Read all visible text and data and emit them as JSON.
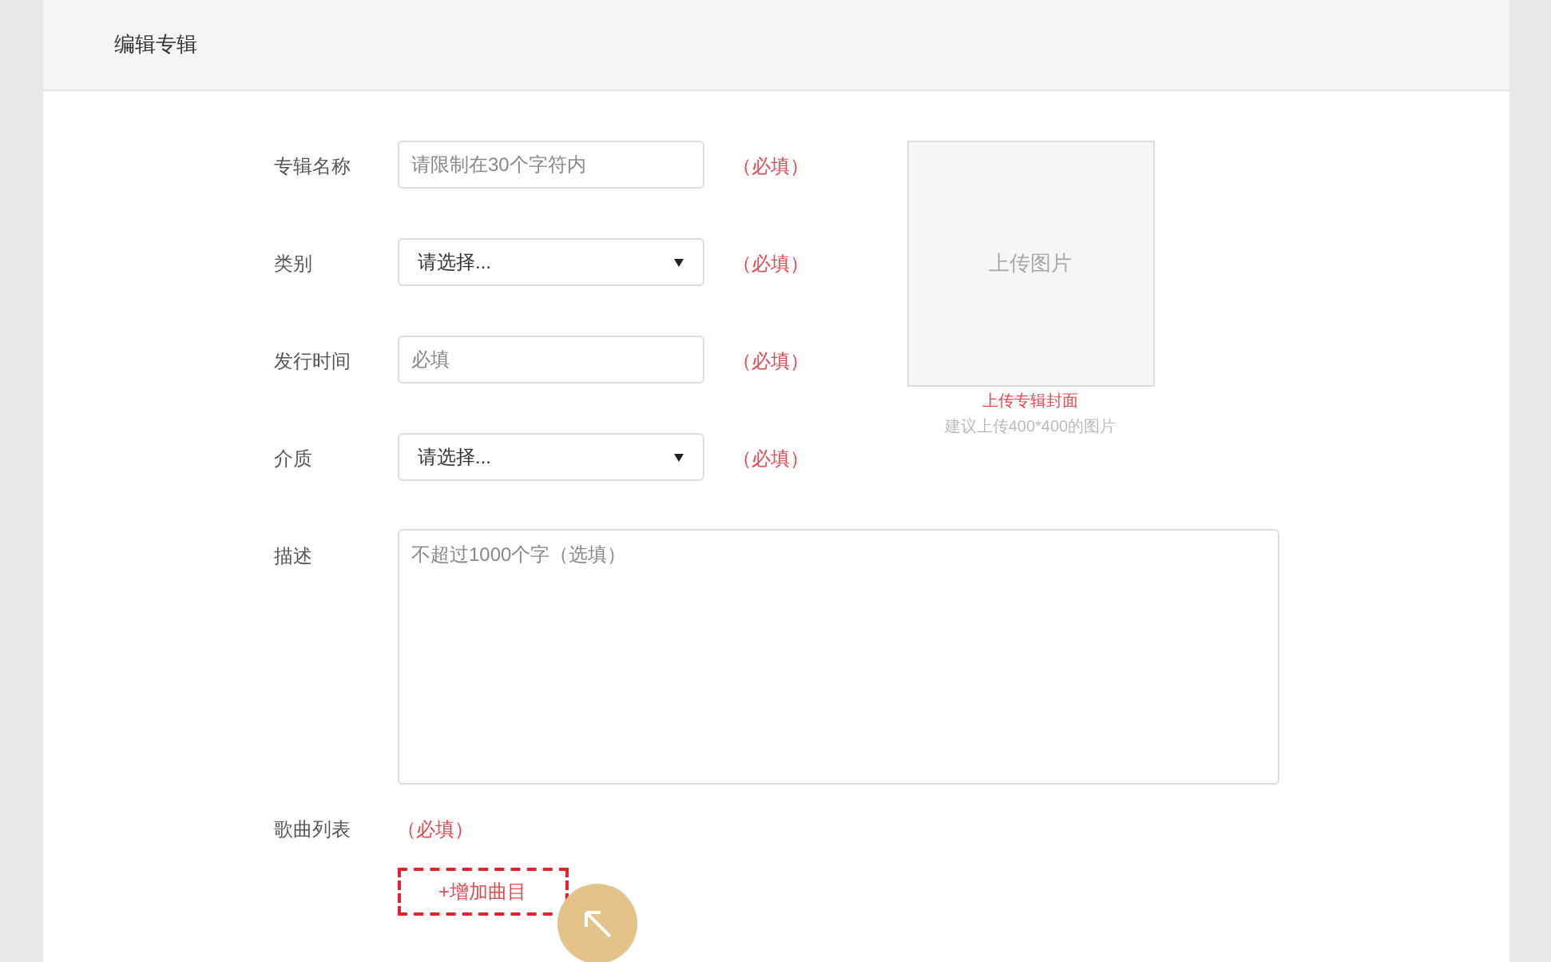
{
  "header": {
    "title": "编辑专辑"
  },
  "fields": [
    {
      "kind": "text",
      "label": "专辑名称",
      "placeholder": "请限制在30个字符内",
      "required": "（必填）"
    },
    {
      "kind": "select",
      "label": "类别",
      "value": "请选择...",
      "required": "（必填）"
    },
    {
      "kind": "text",
      "label": "发行时间",
      "placeholder": "必填",
      "required": "（必填）"
    },
    {
      "kind": "select",
      "label": "介质",
      "value": "请选择...",
      "required": "（必填）"
    }
  ],
  "cover_upload": {
    "box_text": "上传图片",
    "caption": "上传专辑封面",
    "hint": "建议上传400*400的图片"
  },
  "description": {
    "label": "描述",
    "placeholder": "不超过1000个字（选填）"
  },
  "song_list": {
    "label": "歌曲列表",
    "required": "（必填）",
    "add_button": "+增加曲目"
  }
}
